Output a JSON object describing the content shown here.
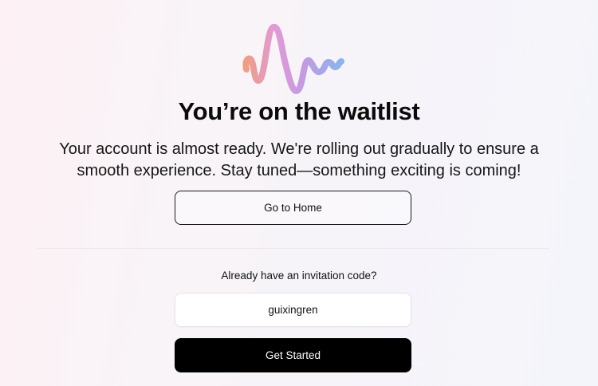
{
  "logo": {
    "icon": "waveform-logo-icon",
    "colors": [
      "#ee9f80",
      "#e29ad6",
      "#b89be6",
      "#8ab4ec"
    ]
  },
  "header": {
    "title": "You’re on the waitlist",
    "subtitle": "Your account is almost ready. We're rolling out gradually to ensure a smooth experience. Stay tuned—something exciting is coming!"
  },
  "actions": {
    "home_label": "Go to Home"
  },
  "invite": {
    "label": "Already have an invitation code?",
    "code_value": "guixingren",
    "submit_label": "Get Started"
  }
}
